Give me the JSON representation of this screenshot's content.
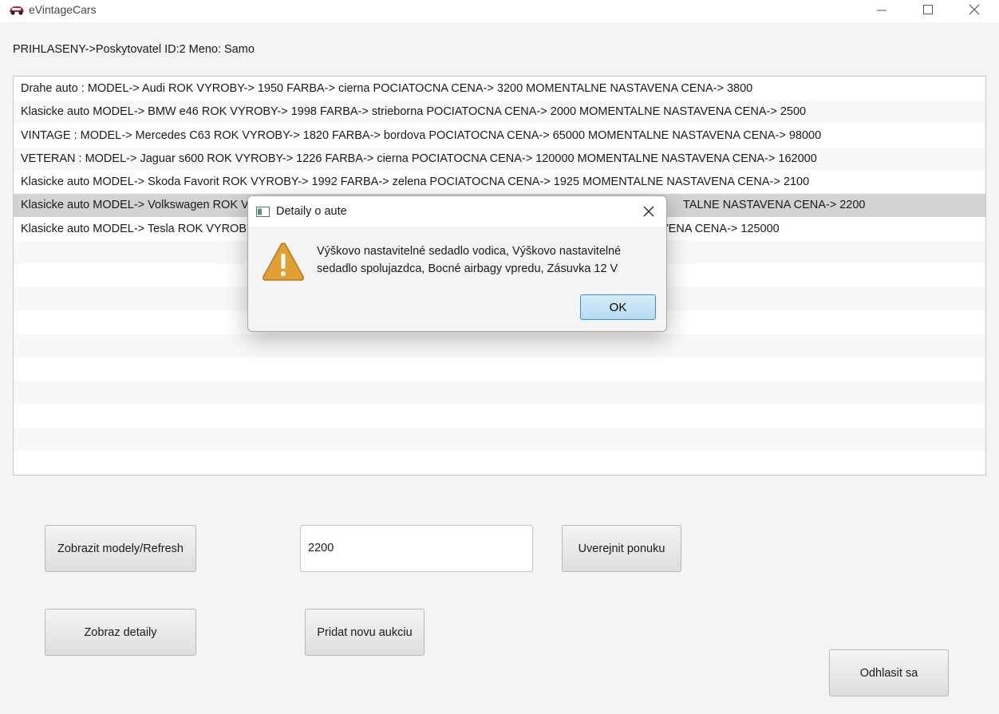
{
  "window": {
    "title": "eVintageCars"
  },
  "status": {
    "logged_in": "PRIHLASENY->Poskytovatel ID:2 Meno: Samo"
  },
  "car_list": {
    "items": [
      "Drahe auto : MODEL-> Audi ROK VYROBY-> 1950 FARBA-> cierna POCIATOCNA CENA-> 3200 MOMENTALNE NASTAVENA CENA-> 3800",
      "Klasicke auto MODEL-> BMW e46 ROK VYROBY-> 1998 FARBA-> strieborna POCIATOCNA CENA-> 2000 MOMENTALNE NASTAVENA CENA-> 2500",
      "VINTAGE : MODEL-> Mercedes C63 ROK VYROBY-> 1820 FARBA-> bordova POCIATOCNA CENA-> 65000 MOMENTALNE NASTAVENA CENA-> 98000",
      "VETERAN : MODEL-> Jaguar s600 ROK VYROBY-> 1226 FARBA-> cierna POCIATOCNA CENA-> 120000 MOMENTALNE NASTAVENA CENA-> 162000",
      "Klasicke auto MODEL-> Skoda Favorit ROK VYROBY-> 1992 FARBA-> zelena POCIATOCNA CENA-> 1925 MOMENTALNE NASTAVENA CENA-> 2100",
      "Klasicke auto MODEL-> Volkswagen ROK V",
      "Klasicke auto MODEL-> Tesla ROK VYROBY"
    ],
    "item_tails": {
      "5": "TALNE NASTAVENA CENA-> 2200",
      "6": "VENA CENA-> 125000"
    }
  },
  "buttons": {
    "show_models": "Zobrazit modely/Refresh",
    "publish_offer": "Uverejnit ponuku",
    "show_details": "Zobraz detaily",
    "add_auction": "Pridat novu aukciu",
    "logout": "Odhlasit sa"
  },
  "price_input": {
    "value": "2200"
  },
  "dialog": {
    "title": "Detaily o aute",
    "message": "Výškovo nastavitelné sedadlo vodica, Výškovo nastavitelné sedadlo spolujazdca, Bocné airbagy vpredu, Zásuvka 12 V",
    "ok_label": "OK"
  },
  "icons": {
    "app": "car-logo-icon",
    "warning": "warning-icon"
  },
  "colors": {
    "selected_row": "#d3d3d3",
    "warning_fill": "#e0a032",
    "ok_border": "#3a8fd1"
  }
}
